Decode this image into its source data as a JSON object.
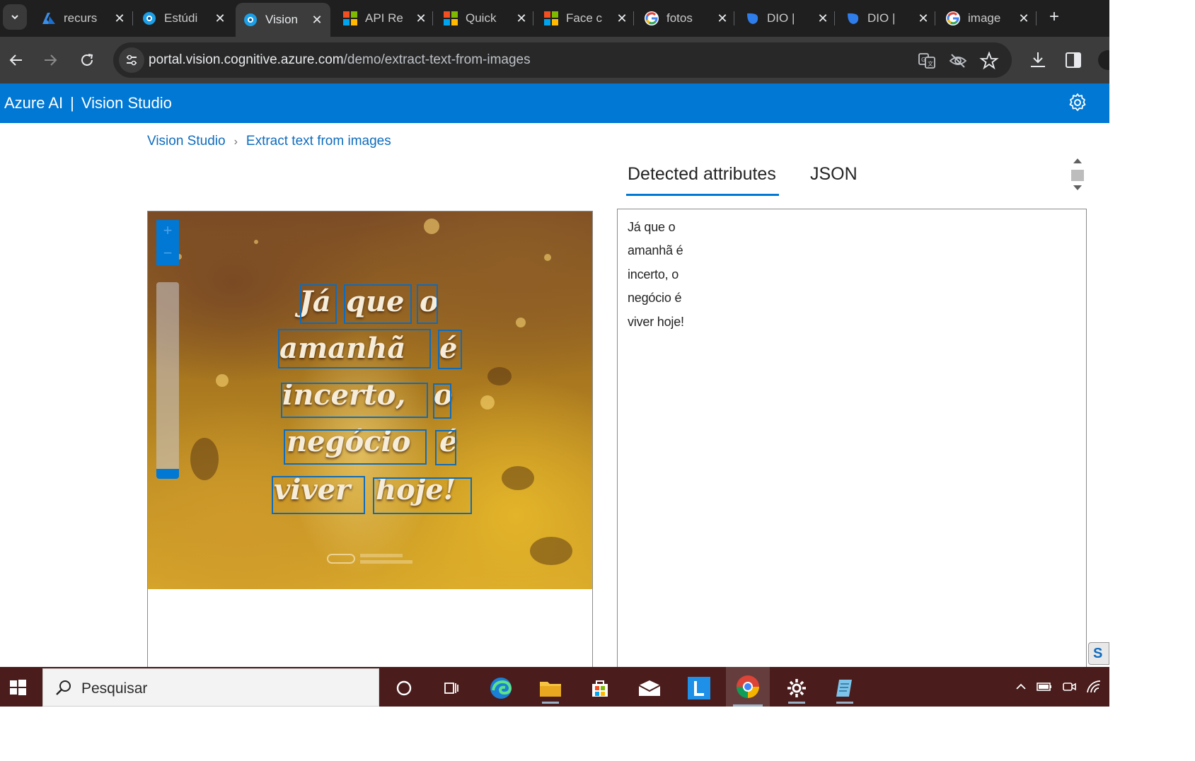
{
  "browser": {
    "tabs": [
      {
        "title": "recurs",
        "icon": "azure-logo-icon"
      },
      {
        "title": "Estúdi",
        "icon": "vision-studio-icon"
      },
      {
        "title": "Vision",
        "icon": "vision-studio-icon",
        "active": true
      },
      {
        "title": "API Re",
        "icon": "microsoft-logo-icon"
      },
      {
        "title": "Quick",
        "icon": "microsoft-logo-icon"
      },
      {
        "title": "Face c",
        "icon": "microsoft-logo-icon"
      },
      {
        "title": "fotos",
        "icon": "google-logo-icon"
      },
      {
        "title": "DIO |",
        "icon": "dio-logo-icon"
      },
      {
        "title": "DIO |",
        "icon": "dio-logo-icon"
      },
      {
        "title": "image",
        "icon": "google-logo-icon"
      }
    ],
    "new_tab_label": "+",
    "url_host": "portal.vision.cognitive.azure.com",
    "url_path": "/demo/extract-text-from-images"
  },
  "app": {
    "brand_left": "Azure AI",
    "brand_sep": "|",
    "brand_right": "Vision Studio",
    "accent": "#0078d4"
  },
  "breadcrumb": {
    "root": "Vision Studio",
    "current": "Extract text from images"
  },
  "result_tabs": {
    "detected": "Detected attributes",
    "json": "JSON"
  },
  "image": {
    "zoom_in": "+",
    "zoom_out": "−",
    "lines": [
      [
        "Já",
        "que",
        "o"
      ],
      [
        "amanhã",
        "é"
      ],
      [
        "incerto,",
        "o"
      ],
      [
        "negócio",
        "é"
      ],
      [
        "viver",
        "hoje!"
      ]
    ]
  },
  "detected_text": [
    "Já que o",
    "amanhã é",
    "incerto, o",
    "negócio é",
    "viver hoje!"
  ],
  "edge_button_label": "S",
  "taskbar": {
    "search_placeholder": "Pesquisar"
  }
}
